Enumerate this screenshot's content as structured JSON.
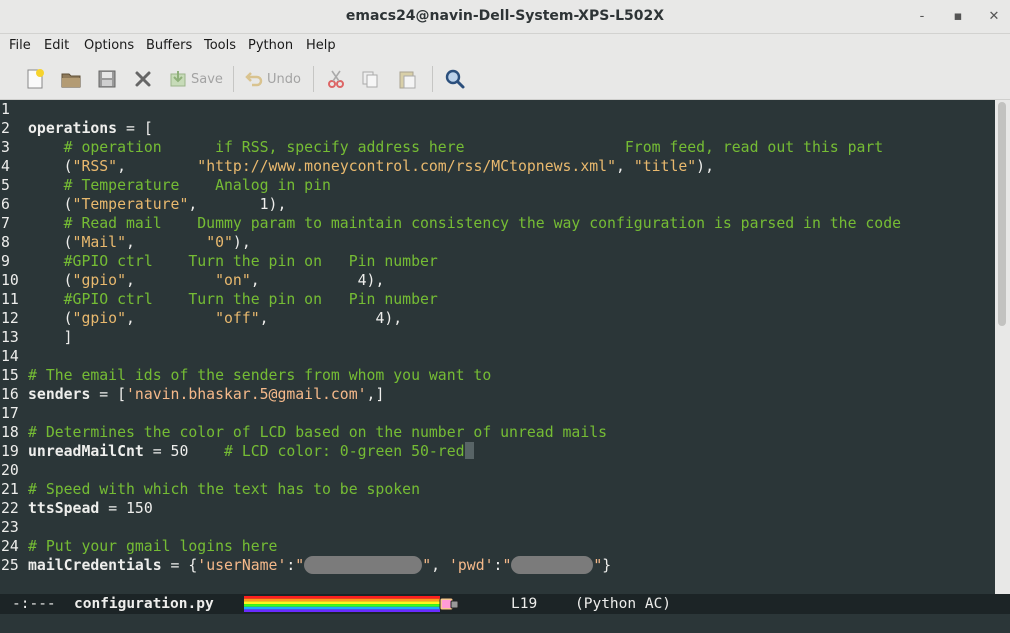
{
  "window": {
    "title": "emacs24@navin-Dell-System-XPS-L502X",
    "minimize_glyph": "‐",
    "maximize_glyph": "▪",
    "close_glyph": "✕"
  },
  "menu": [
    "File",
    "Edit",
    "Options",
    "Buffers",
    "Tools",
    "Python",
    "Help"
  ],
  "toolbar": {
    "save_label": "Save",
    "undo_label": "Undo",
    "icons": [
      "new-file-icon",
      "open-folder-icon",
      "save-disk-icon",
      "close-x-icon",
      "save-icon",
      "undo-icon",
      "cut-icon",
      "copy-icon",
      "paste-icon",
      "search-icon"
    ]
  },
  "editor": {
    "lines": [
      {
        "n": "1",
        "parts": []
      },
      {
        "n": "2",
        "parts": [
          [
            "var",
            "operations"
          ],
          [
            "plain",
            " = ["
          ]
        ]
      },
      {
        "n": "3",
        "parts": [
          [
            "plain",
            "    "
          ],
          [
            "comment",
            "# operation      if RSS, specify address here                  From feed, read out this part"
          ]
        ]
      },
      {
        "n": "4",
        "parts": [
          [
            "plain",
            "    ("
          ],
          [
            "string",
            "\"RSS\""
          ],
          [
            "plain",
            ",        "
          ],
          [
            "string",
            "\"http://www.moneycontrol.com/rss/MCtopnews.xml\""
          ],
          [
            "plain",
            ", "
          ],
          [
            "string",
            "\"title\""
          ],
          [
            "plain",
            "),"
          ]
        ]
      },
      {
        "n": "5",
        "parts": [
          [
            "plain",
            "    "
          ],
          [
            "comment",
            "# Temperature    Analog in pin"
          ]
        ]
      },
      {
        "n": "6",
        "parts": [
          [
            "plain",
            "    ("
          ],
          [
            "string",
            "\"Temperature\""
          ],
          [
            "plain",
            ",       1),"
          ]
        ]
      },
      {
        "n": "7",
        "parts": [
          [
            "plain",
            "    "
          ],
          [
            "comment",
            "# Read mail    Dummy param to maintain consistency the way configuration is parsed in the code"
          ]
        ]
      },
      {
        "n": "8",
        "parts": [
          [
            "plain",
            "    ("
          ],
          [
            "string",
            "\"Mail\""
          ],
          [
            "plain",
            ",        "
          ],
          [
            "string",
            "\"0\""
          ],
          [
            "plain",
            "),"
          ]
        ]
      },
      {
        "n": "9",
        "parts": [
          [
            "plain",
            "    "
          ],
          [
            "comment",
            "#GPIO ctrl    Turn the pin on   Pin number"
          ]
        ]
      },
      {
        "n": "10",
        "parts": [
          [
            "plain",
            "    ("
          ],
          [
            "string",
            "\"gpio\""
          ],
          [
            "plain",
            ",         "
          ],
          [
            "string",
            "\"on\""
          ],
          [
            "plain",
            ",           4),"
          ]
        ]
      },
      {
        "n": "11",
        "parts": [
          [
            "plain",
            "    "
          ],
          [
            "comment",
            "#GPIO ctrl    Turn the pin on   Pin number"
          ]
        ]
      },
      {
        "n": "12",
        "parts": [
          [
            "plain",
            "    ("
          ],
          [
            "string",
            "\"gpio\""
          ],
          [
            "plain",
            ",         "
          ],
          [
            "string",
            "\"off\""
          ],
          [
            "plain",
            ",            4),"
          ]
        ]
      },
      {
        "n": "13",
        "parts": [
          [
            "plain",
            "    ]"
          ]
        ]
      },
      {
        "n": "14",
        "parts": []
      },
      {
        "n": "15",
        "parts": [
          [
            "comment",
            "# The email ids of the senders from whom you want to"
          ]
        ]
      },
      {
        "n": "16",
        "parts": [
          [
            "var",
            "senders"
          ],
          [
            "plain",
            " = ["
          ],
          [
            "str2",
            "'navin.bhaskar.5@gmail.com'"
          ],
          [
            "plain",
            ",]"
          ]
        ]
      },
      {
        "n": "17",
        "parts": []
      },
      {
        "n": "18",
        "parts": [
          [
            "comment",
            "# Determines the color of LCD based on the number of unread mails"
          ]
        ]
      },
      {
        "n": "19",
        "parts": [
          [
            "var",
            "unreadMailCnt"
          ],
          [
            "plain",
            " = 50    "
          ],
          [
            "comment",
            "# LCD color: 0-green 50-red"
          ],
          [
            "cursor",
            ""
          ]
        ]
      },
      {
        "n": "20",
        "parts": []
      },
      {
        "n": "21",
        "parts": [
          [
            "comment",
            "# Speed with which the text has to be spoken"
          ]
        ]
      },
      {
        "n": "22",
        "parts": [
          [
            "var",
            "ttsSpead"
          ],
          [
            "plain",
            " = 150"
          ]
        ]
      },
      {
        "n": "23",
        "parts": []
      },
      {
        "n": "24",
        "parts": [
          [
            "comment",
            "# Put your gmail logins here"
          ]
        ]
      },
      {
        "n": "25",
        "parts": [
          [
            "var",
            "mailCredentials"
          ],
          [
            "plain",
            " = {"
          ],
          [
            "str2",
            "'userName'"
          ],
          [
            "plain",
            ":"
          ],
          [
            "str2",
            "\""
          ],
          [
            "redact",
            ""
          ],
          [
            "str2",
            "\""
          ],
          [
            "plain",
            ", "
          ],
          [
            "str2",
            "'pwd'"
          ],
          [
            "plain",
            ":"
          ],
          [
            "str2",
            "\""
          ],
          [
            "redact-small",
            ""
          ],
          [
            "str2",
            "\""
          ],
          [
            "plain",
            "}"
          ]
        ]
      }
    ]
  },
  "modeline": {
    "status": "-:---",
    "buffer": "configuration.py",
    "line": "L19",
    "mode": "(Python AC)"
  },
  "colors": {
    "editor_bg": "#2b3638",
    "comment": "#8ae234",
    "string": "#e9b96e",
    "modeline_bg": "#1c2426"
  }
}
